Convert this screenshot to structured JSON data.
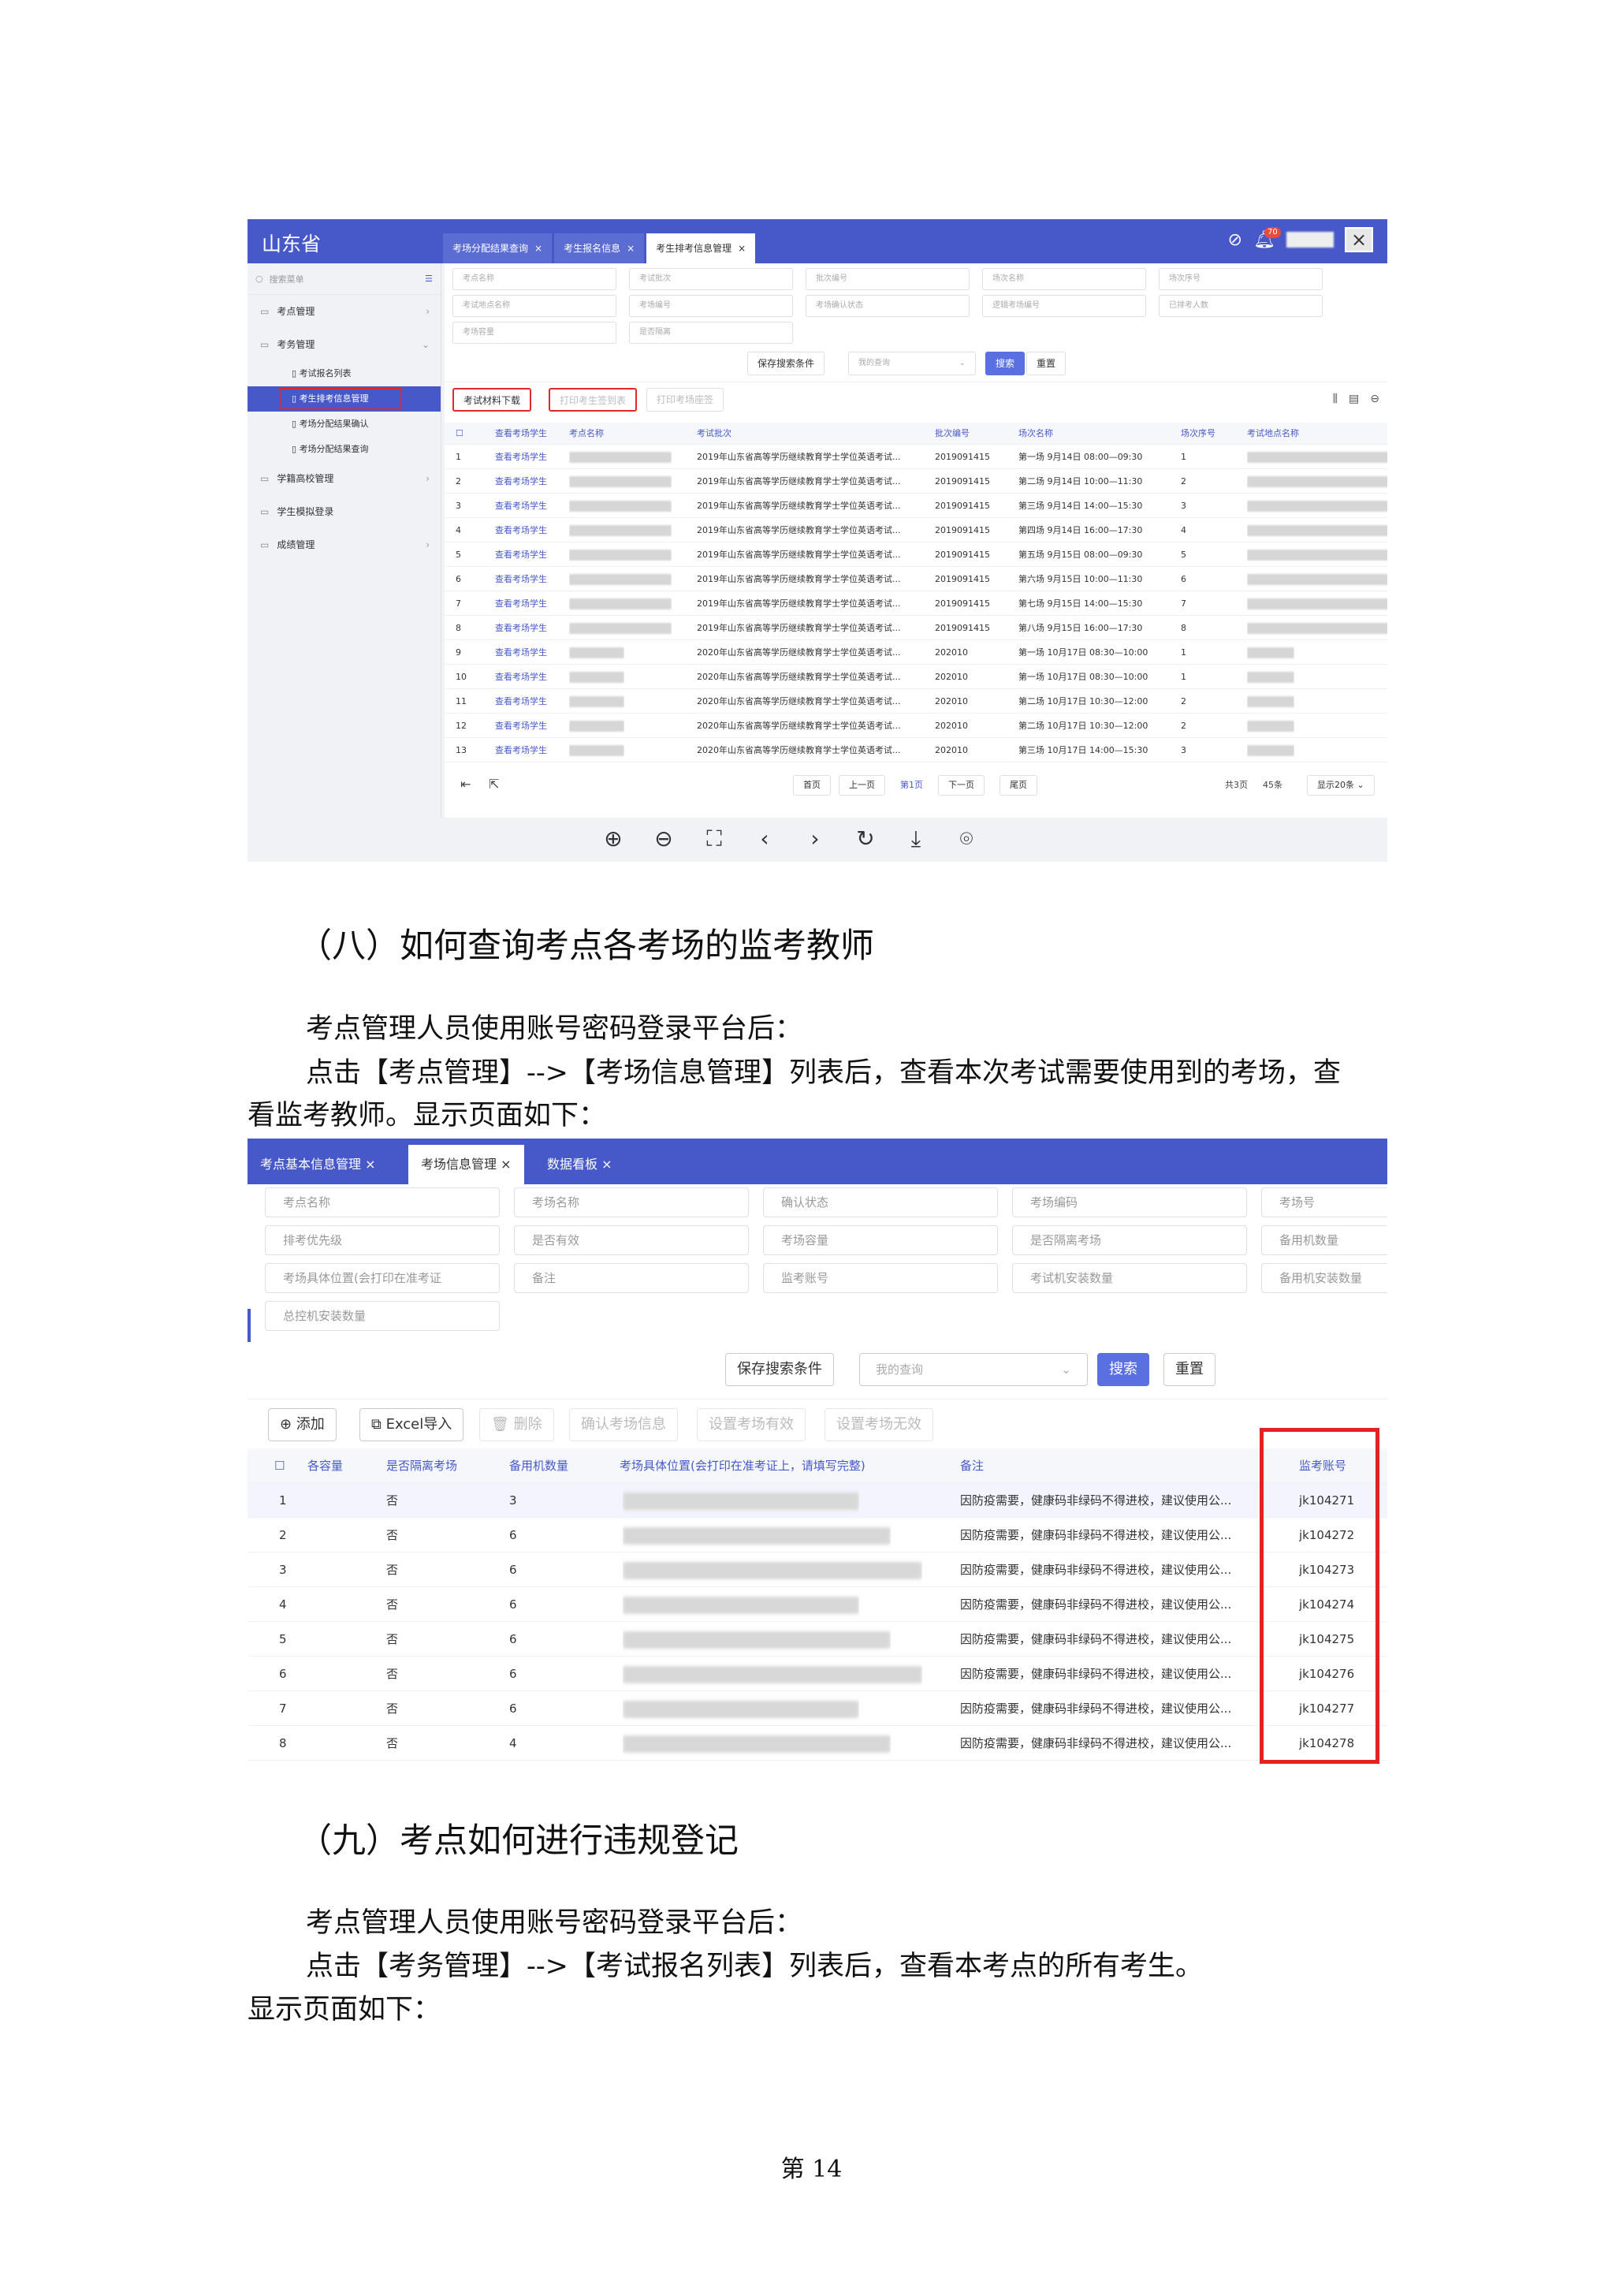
{
  "screenshot1": {
    "brand": "山东省",
    "tabs": [
      "考场分配结果查询",
      "考生报名信息",
      "考生排考信息管理"
    ],
    "notification_count": "70",
    "sidebar": {
      "search_placeholder": "搜索菜单",
      "items": [
        "考点管理",
        "考务管理",
        "学籍高校管理",
        "学生模拟登录",
        "成绩管理"
      ],
      "subitems": [
        "考试报名列表",
        "考生排考信息管理",
        "考场分配结果确认",
        "考场分配结果查询"
      ]
    },
    "filters": [
      "考点名称",
      "考试批次",
      "批次编号",
      "场次名称",
      "场次序号",
      "考试地点名称",
      "考场编号",
      "考场确认状态",
      "逻辑考场编号",
      "已排考人数",
      "考场容量",
      "是否隔离"
    ],
    "buttons": {
      "save_search": "保存搜索条件",
      "my_query": "我的查询",
      "search": "搜索",
      "reset": "重置",
      "download": "考试材料下载",
      "print_sign": "打印考生签到表",
      "print_seat": "打印考场座签"
    },
    "columns": [
      "查看考场学生",
      "考点名称",
      "考试批次",
      "批次编号",
      "场次名称",
      "场次序号",
      "考试地点名称"
    ],
    "rows": [
      {
        "n": "1",
        "link": "查看考场学生",
        "batch": "2019年山东省高等学历继续教育学士学位英语考试...",
        "code": "2019091415",
        "session": "第一场 9月14日 08:00—09:30",
        "seq": "1"
      },
      {
        "n": "2",
        "link": "查看考场学生",
        "batch": "2019年山东省高等学历继续教育学士学位英语考试...",
        "code": "2019091415",
        "session": "第二场 9月14日 10:00—11:30",
        "seq": "2"
      },
      {
        "n": "3",
        "link": "查看考场学生",
        "batch": "2019年山东省高等学历继续教育学士学位英语考试...",
        "code": "2019091415",
        "session": "第三场 9月14日 14:00—15:30",
        "seq": "3"
      },
      {
        "n": "4",
        "link": "查看考场学生",
        "batch": "2019年山东省高等学历继续教育学士学位英语考试...",
        "code": "2019091415",
        "session": "第四场 9月14日 16:00—17:30",
        "seq": "4"
      },
      {
        "n": "5",
        "link": "查看考场学生",
        "batch": "2019年山东省高等学历继续教育学士学位英语考试...",
        "code": "2019091415",
        "session": "第五场 9月15日 08:00—09:30",
        "seq": "5"
      },
      {
        "n": "6",
        "link": "查看考场学生",
        "batch": "2019年山东省高等学历继续教育学士学位英语考试...",
        "code": "2019091415",
        "session": "第六场 9月15日 10:00—11:30",
        "seq": "6"
      },
      {
        "n": "7",
        "link": "查看考场学生",
        "batch": "2019年山东省高等学历继续教育学士学位英语考试...",
        "code": "2019091415",
        "session": "第七场 9月15日 14:00—15:30",
        "seq": "7"
      },
      {
        "n": "8",
        "link": "查看考场学生",
        "batch": "2019年山东省高等学历继续教育学士学位英语考试...",
        "code": "2019091415",
        "session": "第八场 9月15日 16:00—17:30",
        "seq": "8"
      },
      {
        "n": "9",
        "link": "查看考场学生",
        "batch": "2020年山东省高等学历继续教育学士学位英语考试...",
        "code": "202010",
        "session": "第一场 10月17日 08:30—10:00",
        "seq": "1"
      },
      {
        "n": "10",
        "link": "查看考场学生",
        "batch": "2020年山东省高等学历继续教育学士学位英语考试...",
        "code": "202010",
        "session": "第一场 10月17日 08:30—10:00",
        "seq": "1"
      },
      {
        "n": "11",
        "link": "查看考场学生",
        "batch": "2020年山东省高等学历继续教育学士学位英语考试...",
        "code": "202010",
        "session": "第二场 10月17日 10:30—12:00",
        "seq": "2"
      },
      {
        "n": "12",
        "link": "查看考场学生",
        "batch": "2020年山东省高等学历继续教育学士学位英语考试...",
        "code": "202010",
        "session": "第二场 10月17日 10:30—12:00",
        "seq": "2"
      },
      {
        "n": "13",
        "link": "查看考场学生",
        "batch": "2020年山东省高等学历继续教育学士学位英语考试...",
        "code": "202010",
        "session": "第三场 10月17日 14:00—15:30",
        "seq": "3"
      }
    ],
    "pager": {
      "first": "首页",
      "prev": "上一页",
      "current": "第1页",
      "next": "下一页",
      "last": "尾页",
      "total": "共3页",
      "count": "45条",
      "per_page": "显示20条"
    }
  },
  "section8": {
    "heading": "（八）如何查询考点各考场的监考教师",
    "p1": "考点管理人员使用账号密码登录平台后：",
    "p2a": "点击【考点管理】-->【考场信息管理】列表后，查看本次考试需要使用到的考场，查",
    "p2b": "看监考教师。显示页面如下："
  },
  "screenshot2": {
    "tabs": [
      "考点基本信息管理",
      "考场信息管理",
      "数据看板"
    ],
    "filters": [
      "考点名称",
      "考场名称",
      "确认状态",
      "考场编码",
      "考场号",
      "排考优先级",
      "是否有效",
      "考场容量",
      "是否隔离考场",
      "备用机数量",
      "考场具体位置(会打印在准考证",
      "备注",
      "监考账号",
      "考试机安装数量",
      "备用机安装数量",
      "总控机安装数量"
    ],
    "buttons": {
      "save_search": "保存搜索条件",
      "my_query": "我的查询",
      "search": "搜索",
      "reset": "重置",
      "add": "添加",
      "excel": "Excel导入",
      "delete": "删除",
      "confirm": "确认考场信息",
      "set_valid": "设置考场有效",
      "set_invalid": "设置考场无效"
    },
    "columns": [
      "各容量",
      "是否隔离考场",
      "备用机数量",
      "考场具体位置(会打印在准考证上，请填写完整)",
      "备注",
      "监考账号"
    ],
    "rows": [
      {
        "n": "1",
        "isolated": "否",
        "spare": "3",
        "remark": "因防疫需要，健康码非绿码不得进校，建议使用公...",
        "account": "jk104271"
      },
      {
        "n": "2",
        "isolated": "否",
        "spare": "6",
        "remark": "因防疫需要，健康码非绿码不得进校，建议使用公...",
        "account": "jk104272"
      },
      {
        "n": "3",
        "isolated": "否",
        "spare": "6",
        "remark": "因防疫需要，健康码非绿码不得进校，建议使用公...",
        "account": "jk104273"
      },
      {
        "n": "4",
        "isolated": "否",
        "spare": "6",
        "remark": "因防疫需要，健康码非绿码不得进校，建议使用公...",
        "account": "jk104274"
      },
      {
        "n": "5",
        "isolated": "否",
        "spare": "6",
        "remark": "因防疫需要，健康码非绿码不得进校，建议使用公...",
        "account": "jk104275"
      },
      {
        "n": "6",
        "isolated": "否",
        "spare": "6",
        "remark": "因防疫需要，健康码非绿码不得进校，建议使用公...",
        "account": "jk104276"
      },
      {
        "n": "7",
        "isolated": "否",
        "spare": "6",
        "remark": "因防疫需要，健康码非绿码不得进校，建议使用公...",
        "account": "jk104277"
      },
      {
        "n": "8",
        "isolated": "否",
        "spare": "4",
        "remark": "因防疫需要，健康码非绿码不得进校，建议使用公...",
        "account": "jk104278"
      }
    ]
  },
  "section9": {
    "heading": "（九）考点如何进行违规登记",
    "p1": "考点管理人员使用账号密码登录平台后：",
    "p2": "点击【考务管理】-->【考试报名列表】列表后，查看本考点的所有考生。",
    "p3": "显示页面如下："
  },
  "page_number": "第 14"
}
